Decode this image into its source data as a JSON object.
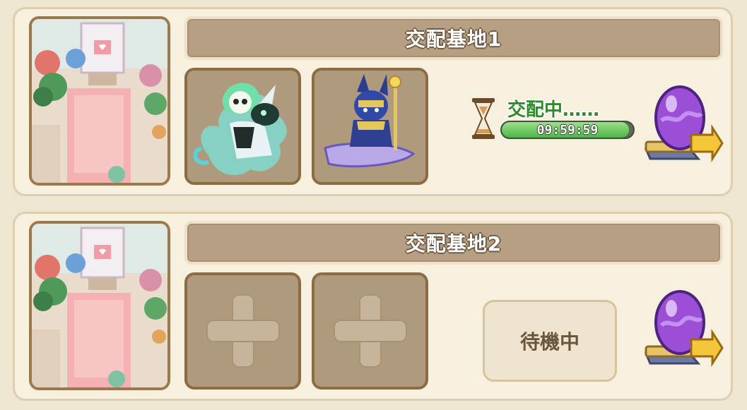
{
  "bases": [
    {
      "title": "交配基地1",
      "state": "breeding",
      "status_label": "交配中……",
      "timer": "09:59:59",
      "progress": 0.97,
      "slots": [
        "green-ghost-rider-pet",
        "anubis-carpet-pet"
      ]
    },
    {
      "title": "交配基地2",
      "state": "idle",
      "idle_label": "待機中",
      "slots": [
        "empty",
        "empty"
      ]
    }
  ],
  "colors": {
    "title_bg": "#b79f84",
    "status_green": "#2f8a2a",
    "progress_fill": "#4fb347",
    "egg_purple": "#9a4fd6"
  }
}
